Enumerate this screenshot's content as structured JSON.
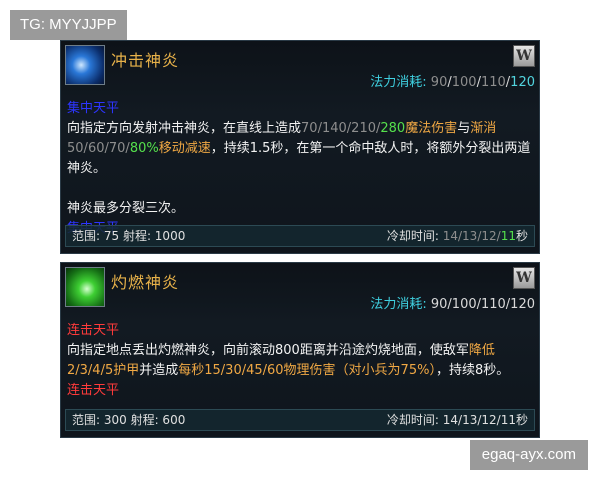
{
  "watermark_top": "TG: MYYJJPP",
  "watermark_bottom": "egaq-ayx.com",
  "abilities": [
    {
      "name": "冲击神炎",
      "key": "W",
      "cost_label": "法力消耗:",
      "cost_values": [
        "90",
        "100",
        "110",
        "120"
      ],
      "tag": "集中天平",
      "desc_1": "向指定方向发射冲击神炎，在直线上造成",
      "damage_values": [
        "70",
        "140",
        "210",
        "280"
      ],
      "damage_label": "魔法伤害",
      "desc_and": "与",
      "slow_word": "渐消",
      "slow_values": [
        "50",
        "60",
        "70",
        "80%"
      ],
      "slow_label": "移动减速",
      "desc_2": "，持续1.5秒，在第一个命中敌人时，将额外分裂出两道神炎。",
      "desc_3": "神炎最多分裂三次。",
      "tag_2": "集中天平",
      "range_text": "范围: 75 射程: 1000",
      "cooldown_label": "冷却时间:",
      "cooldown_values": [
        "14",
        "13",
        "12",
        "11"
      ],
      "cooldown_unit": "秒",
      "icon": "blue-lightning-icon"
    },
    {
      "name": "灼燃神炎",
      "key": "W",
      "cost_label": "法力消耗:",
      "cost_text": "90/100/110/120",
      "tag": "连击天平",
      "desc_1": "向指定地点丢出灼燃神炎，向前滚动800距离并沿途灼烧地面，使敌军",
      "armor_text": "降低2/3/4/5护甲",
      "desc_2": "并造成",
      "dps_text": "每秒15/30/45/60物理伤害（对小兵为75%）",
      "desc_3": "，持续8秒。",
      "tag_2": "连击天平",
      "range_text": "范围: 300 射程: 600",
      "cooldown_text": "冷却时间: 14/13/12/11秒",
      "icon": "green-flame-icon"
    }
  ],
  "colors": {
    "title": "#e8b24a",
    "cost_label": "#3fd0e0",
    "tag_blue": "#2d35ff",
    "tag_red": "#ff3b3b",
    "damage": "#f0a844",
    "highlight": "#55e04c"
  }
}
